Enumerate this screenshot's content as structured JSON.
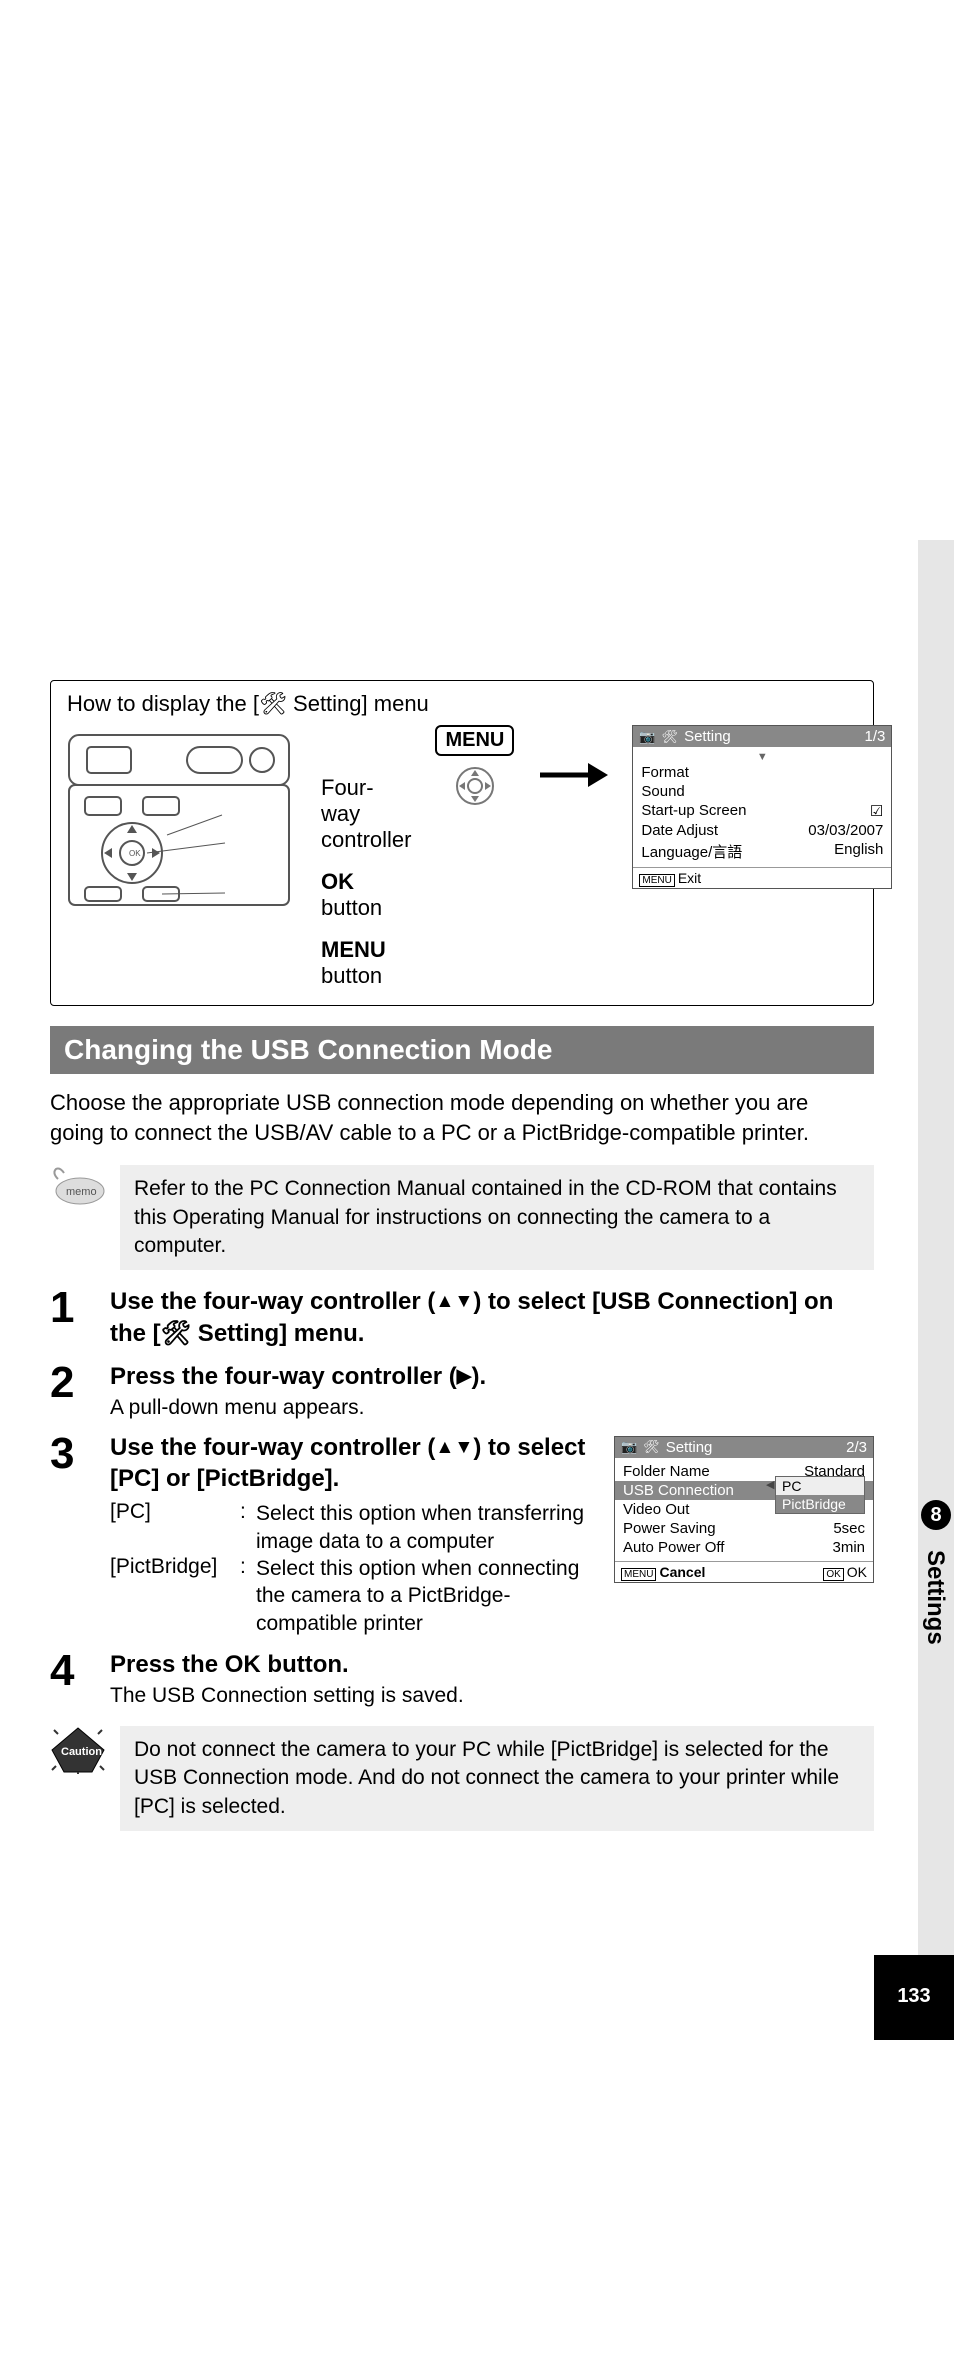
{
  "right": {
    "chapter_num": "8",
    "chapter_label": "Settings",
    "page_num": "133"
  },
  "howto": {
    "title_pre": "How to display the [",
    "title_post": " Setting] menu",
    "callouts": {
      "four_way": "Four-way controller",
      "ok": " button",
      "ok_label": "OK",
      "menu_label": "MENU",
      "menu": " button"
    },
    "menu_badge": "MENU"
  },
  "lcd1": {
    "title": "Setting",
    "page": "1/3",
    "rows": {
      "format": "Format",
      "sound": "Sound",
      "startup": "Start-up Screen",
      "date_adjust": "Date Adjust",
      "date_val": "03/03/2007",
      "lang": "Language/言語",
      "lang_val": "English"
    },
    "footer_exit": "Exit",
    "footer_menu": "MENU"
  },
  "section_header": "Changing the USB Connection Mode",
  "intro": "Choose the appropriate USB connection mode depending on whether you are going to connect the USB/AV cable to a PC or a PictBridge-compatible printer.",
  "memo": "Refer to the PC Connection Manual contained in the CD-ROM that contains this Operating Manual for instructions on connecting the camera to a computer.",
  "steps": {
    "s1": {
      "num": "1",
      "head_a": "Use the four-way controller (",
      "head_b": ") to select [USB Connection] on the [",
      "head_c": " Setting] menu."
    },
    "s2": {
      "num": "2",
      "head_a": "Press the four-way controller (",
      "head_b": ").",
      "sub": "A pull-down menu appears."
    },
    "s3": {
      "num": "3",
      "head_a": "Use the four-way controller (",
      "head_b": ") to select [PC] or [PictBridge].",
      "opt_pc_label": "[PC]",
      "opt_pc_desc": "Select this option when transferring image data to a computer",
      "opt_pb_label": "[PictBridge]",
      "opt_pb_desc": "Select this option when connecting the camera to a PictBridge-compatible printer"
    },
    "s4": {
      "num": "4",
      "head_a": "Press the ",
      "head_ok": "OK",
      "head_b": " button.",
      "sub": "The USB Connection setting is saved."
    }
  },
  "lcd2": {
    "title": "Setting",
    "page": "2/3",
    "rows": {
      "folder": "Folder Name",
      "folder_val": "Standard",
      "usb": "USB Connection",
      "usb_opt1": "PC",
      "usb_opt2": "PictBridge",
      "video": "Video Out",
      "power": "Power Saving",
      "power_val": "5sec",
      "auto": "Auto Power Off",
      "auto_val": "3min"
    },
    "footer_cancel": "Cancel",
    "footer_menu": "MENU",
    "footer_ok_box": "OK",
    "footer_ok": "OK"
  },
  "caution": "Do not connect the camera to your PC while [PictBridge] is selected for the USB Connection mode. And do not connect the camera to your printer while [PC] is selected.",
  "memo_label": "memo",
  "caution_label": "Caution"
}
